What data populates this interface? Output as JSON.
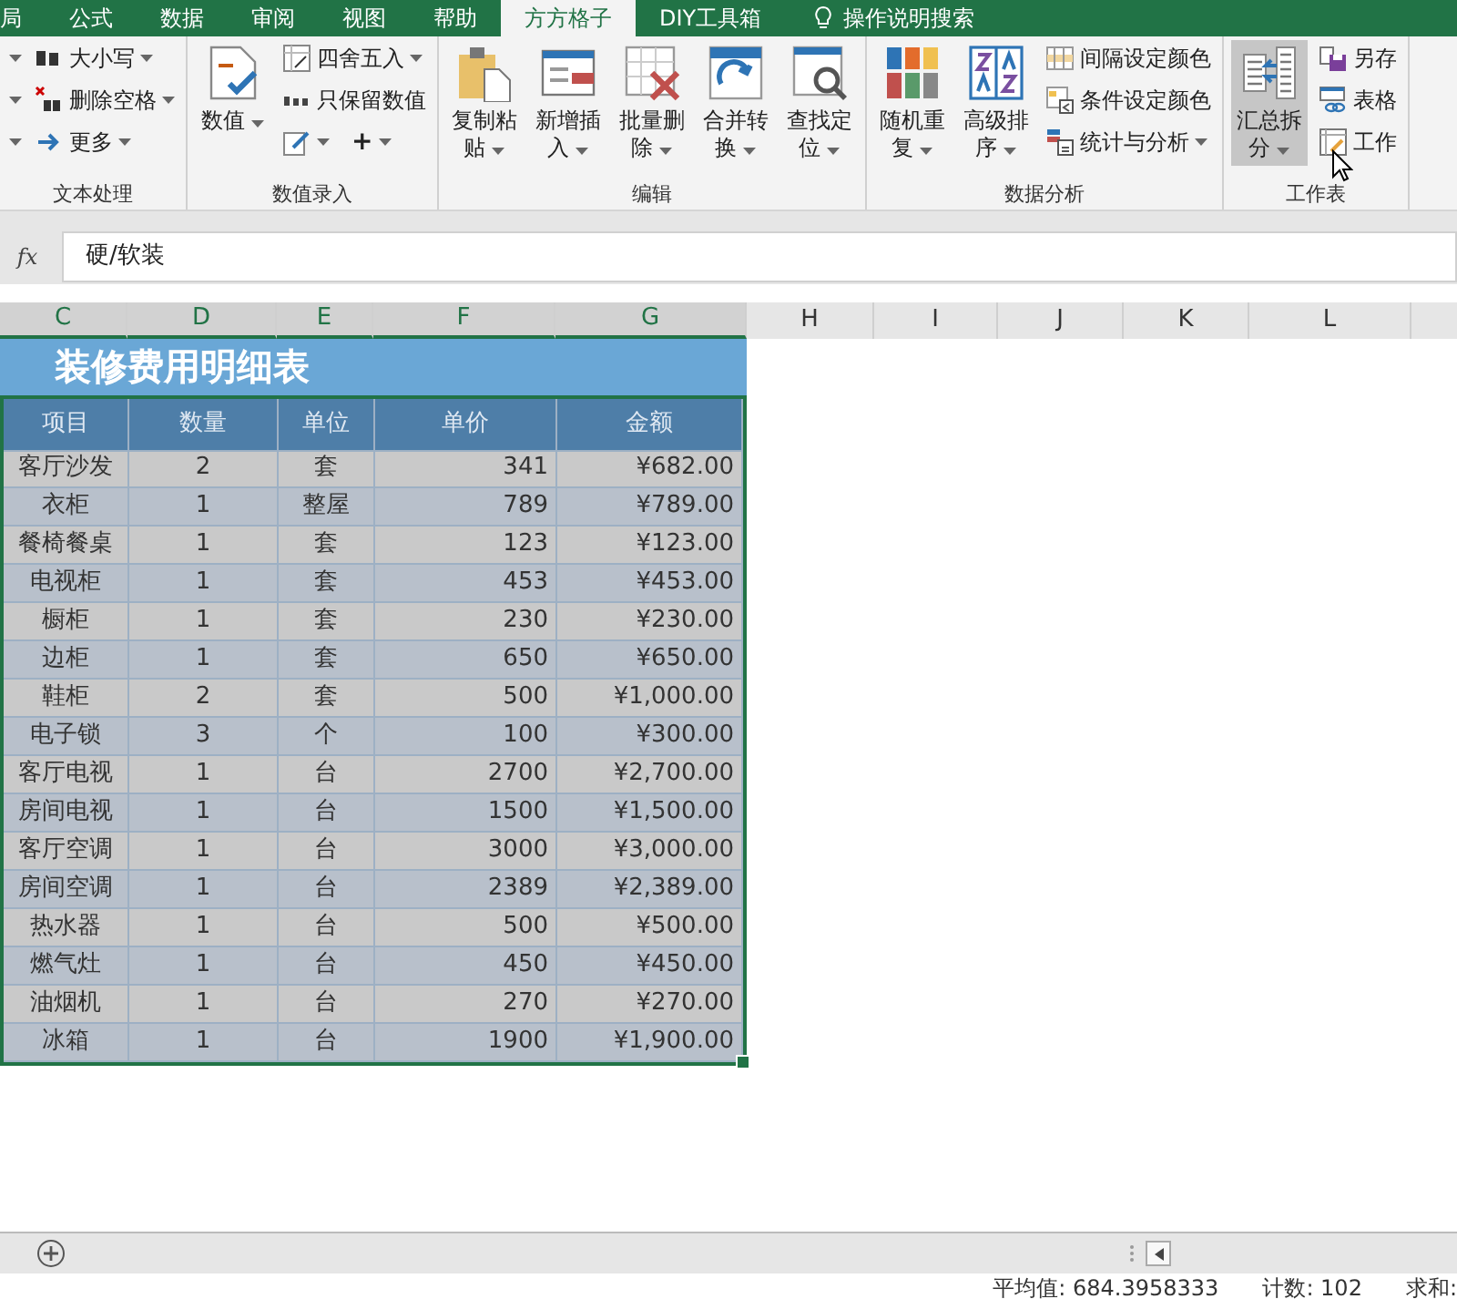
{
  "tabs": [
    {
      "label": "局",
      "selected": false
    },
    {
      "label": "公式",
      "selected": false
    },
    {
      "label": "数据",
      "selected": false
    },
    {
      "label": "审阅",
      "selected": false
    },
    {
      "label": "视图",
      "selected": false
    },
    {
      "label": "帮助",
      "selected": false
    },
    {
      "label": "方方格子",
      "selected": true
    },
    {
      "label": "DIY工具箱",
      "selected": false
    }
  ],
  "search_hint": "操作说明搜索",
  "ribbon": {
    "groups": [
      {
        "label": "文本处理",
        "columns": [
          [
            {
              "kind": "caret",
              "dropdown": true
            },
            {
              "kind": "caret",
              "dropdown": true
            },
            {
              "kind": "caret",
              "dropdown": true
            }
          ],
          [
            {
              "kind": "small",
              "label": "大小写",
              "dropdown": true,
              "hovered": false
            },
            {
              "kind": "small",
              "label": "删除空格",
              "dropdown": true,
              "hovered": false
            },
            {
              "kind": "small",
              "label": "更多",
              "dropdown": true,
              "hovered": false
            }
          ]
        ]
      },
      {
        "label": "数值录入",
        "columns": [
          [
            {
              "kind": "big",
              "label": "数值",
              "dropdown": true,
              "hovered": false
            }
          ],
          [
            {
              "kind": "small",
              "label": "四舍五入",
              "dropdown": true,
              "hovered": false
            },
            {
              "kind": "small",
              "label": "只保留数值",
              "dropdown": false,
              "hovered": false
            },
            {
              "kind": "pair",
              "items": [
                {
                  "dropdown": true,
                  "hovered": false
                },
                {
                  "label": "+",
                  "dropdown": true,
                  "hovered": false
                }
              ]
            }
          ]
        ]
      },
      {
        "label": "编辑",
        "columns": [
          [
            {
              "kind": "big",
              "label": "复制粘贴",
              "dropdown": true,
              "hovered": false
            }
          ],
          [
            {
              "kind": "big",
              "label": "新增插入",
              "dropdown": true,
              "hovered": false
            }
          ],
          [
            {
              "kind": "big",
              "label": "批量删除",
              "dropdown": true,
              "hovered": false
            }
          ],
          [
            {
              "kind": "big",
              "label": "合并转换",
              "dropdown": true,
              "hovered": false
            }
          ],
          [
            {
              "kind": "big",
              "label": "查找定位",
              "dropdown": true,
              "hovered": false
            }
          ]
        ]
      },
      {
        "label": "数据分析",
        "columns": [
          [
            {
              "kind": "big",
              "label": "随机重复",
              "dropdown": true,
              "hovered": false
            }
          ],
          [
            {
              "kind": "big",
              "label": "高级排序",
              "dropdown": true,
              "hovered": false
            }
          ],
          [
            {
              "kind": "small",
              "label": "间隔设定颜色",
              "dropdown": false,
              "hovered": false
            },
            {
              "kind": "small",
              "label": "条件设定颜色",
              "dropdown": false,
              "hovered": false
            },
            {
              "kind": "small",
              "label": "统计与分析",
              "dropdown": true,
              "hovered": false
            }
          ]
        ]
      },
      {
        "label": "工作表",
        "columns": [
          [
            {
              "kind": "big",
              "label": "汇总拆分",
              "dropdown": true,
              "hovered": true
            }
          ],
          [
            {
              "kind": "small",
              "label": "另存",
              "dropdown": false,
              "hovered": false
            },
            {
              "kind": "small",
              "label": "表格",
              "dropdown": false,
              "hovered": false
            },
            {
              "kind": "small",
              "label": "工作",
              "dropdown": false,
              "hovered": false
            }
          ]
        ]
      }
    ]
  },
  "formula_bar": {
    "fx": "fx",
    "value": "硬/软装"
  },
  "columns": [
    {
      "label": "C",
      "selected": true
    },
    {
      "label": "D",
      "selected": true
    },
    {
      "label": "E",
      "selected": true
    },
    {
      "label": "F",
      "selected": true
    },
    {
      "label": "G",
      "selected": true
    },
    {
      "label": "H",
      "selected": false
    },
    {
      "label": "I",
      "selected": false
    },
    {
      "label": "J",
      "selected": false
    },
    {
      "label": "K",
      "selected": false
    },
    {
      "label": "L",
      "selected": false
    }
  ],
  "table": {
    "title": "装修费用明细表",
    "header": [
      "项目",
      "数量",
      "单位",
      "单价",
      "金额"
    ],
    "rows": [
      [
        "客厅沙发",
        "2",
        "套",
        "341",
        "¥682.00"
      ],
      [
        "衣柜",
        "1",
        "整屋",
        "789",
        "¥789.00"
      ],
      [
        "餐椅餐桌",
        "1",
        "套",
        "123",
        "¥123.00"
      ],
      [
        "电视柜",
        "1",
        "套",
        "453",
        "¥453.00"
      ],
      [
        "橱柜",
        "1",
        "套",
        "230",
        "¥230.00"
      ],
      [
        "边柜",
        "1",
        "套",
        "650",
        "¥650.00"
      ],
      [
        "鞋柜",
        "2",
        "套",
        "500",
        "¥1,000.00"
      ],
      [
        "电子锁",
        "3",
        "个",
        "100",
        "¥300.00"
      ],
      [
        "客厅电视",
        "1",
        "台",
        "2700",
        "¥2,700.00"
      ],
      [
        "房间电视",
        "1",
        "台",
        "1500",
        "¥1,500.00"
      ],
      [
        "客厅空调",
        "1",
        "台",
        "3000",
        "¥3,000.00"
      ],
      [
        "房间空调",
        "1",
        "台",
        "2389",
        "¥2,389.00"
      ],
      [
        "热水器",
        "1",
        "台",
        "500",
        "¥500.00"
      ],
      [
        "燃气灶",
        "1",
        "台",
        "450",
        "¥450.00"
      ],
      [
        "油烟机",
        "1",
        "台",
        "270",
        "¥270.00"
      ],
      [
        "冰箱",
        "1",
        "台",
        "1900",
        "¥1,900.00"
      ]
    ]
  },
  "status_bar": [
    "平均值: 684.3958333",
    "计数: 102",
    "求和:"
  ]
}
